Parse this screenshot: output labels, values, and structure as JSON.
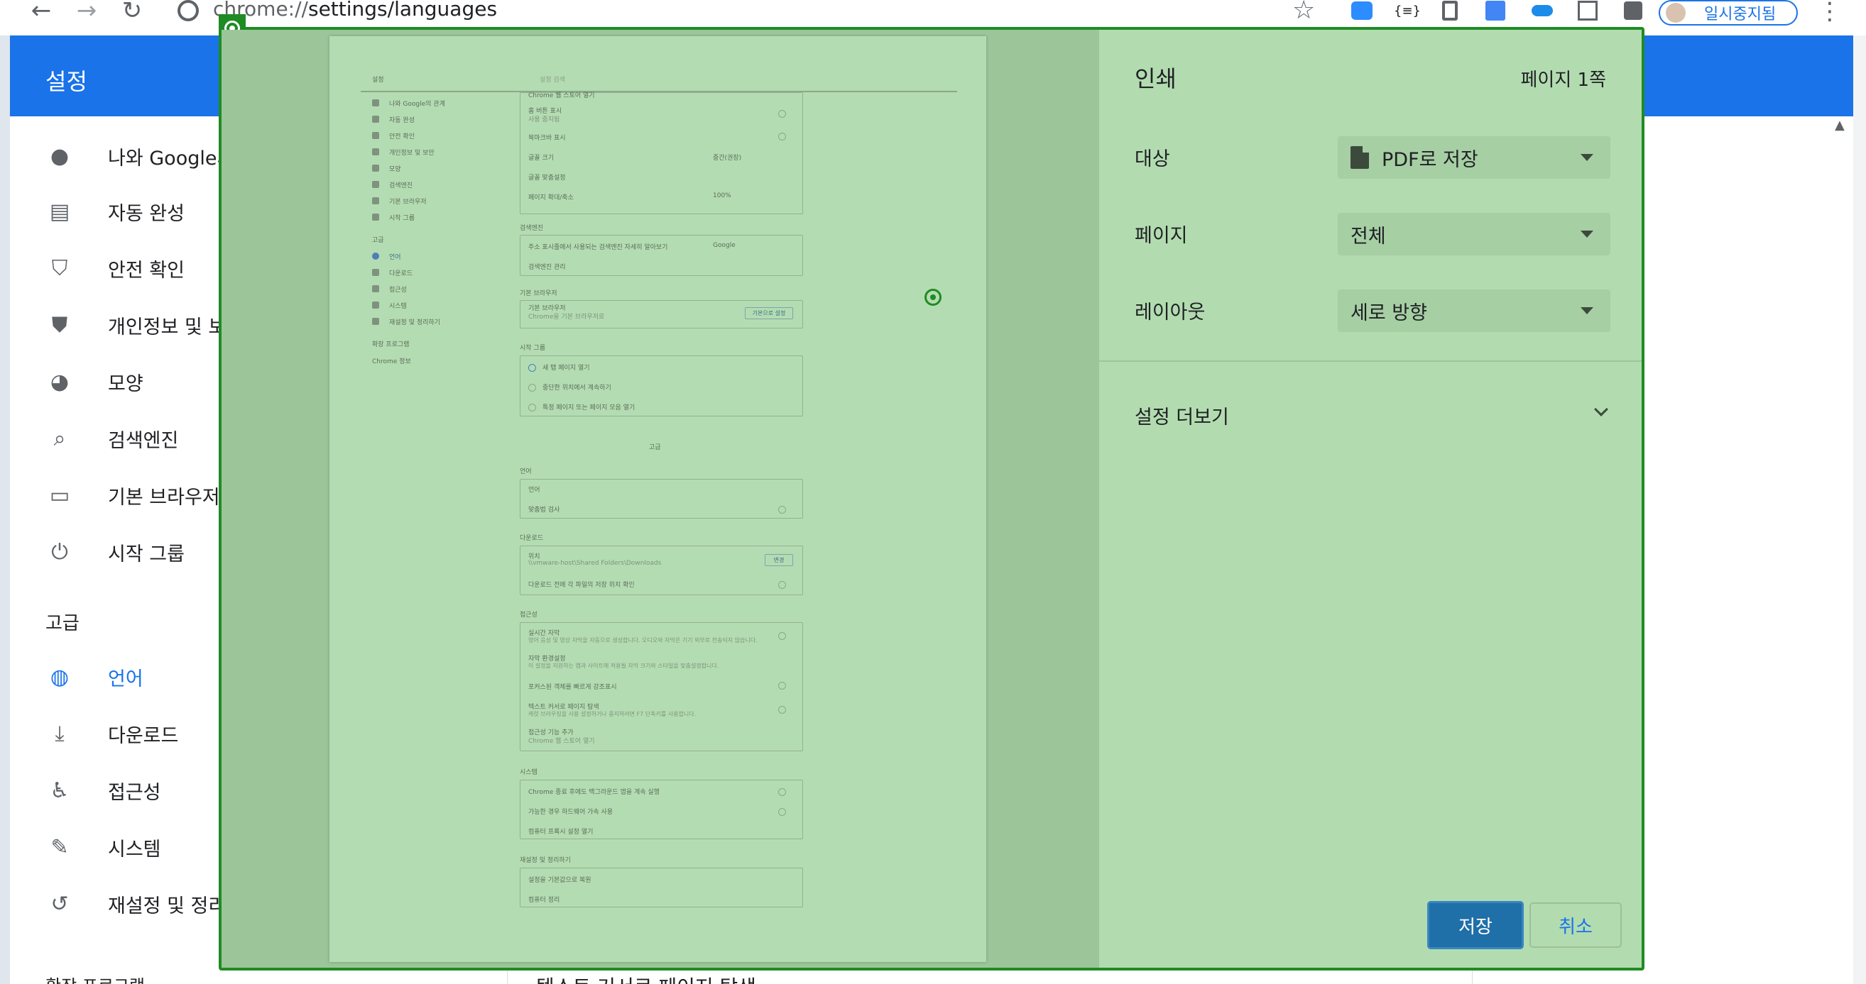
{
  "browser": {
    "back": "←",
    "forward": "→",
    "reload": "↻",
    "url_host": "chrome://",
    "url_path": "settings/languages",
    "url_prefix_hidden": "Chrome",
    "star": "☆",
    "profile_label": "일시중지됨",
    "more": "⋮",
    "extensions": [
      "zoom-icon",
      "json-viewer-icon",
      "office-icon",
      "google-translate-icon",
      "onedrive-icon",
      "uipath-icon",
      "puzzle-icon"
    ]
  },
  "settings": {
    "title": "설정",
    "sidebar": [
      {
        "label": "나와 Google의",
        "icon": "person-icon"
      },
      {
        "label": "자동 완성",
        "icon": "clipboard-icon"
      },
      {
        "label": "안전 확인",
        "icon": "shield-check-icon"
      },
      {
        "label": "개인정보 및 보",
        "icon": "shield-half-icon"
      },
      {
        "label": "모양",
        "icon": "palette-icon"
      },
      {
        "label": "검색엔진",
        "icon": "search-icon"
      },
      {
        "label": "기본 브라우저",
        "icon": "browser-icon"
      },
      {
        "label": "시작 그룹",
        "icon": "power-icon"
      }
    ],
    "advanced_label": "고급",
    "advanced_items": [
      {
        "label": "언어",
        "icon": "globe-icon"
      },
      {
        "label": "다운로드",
        "icon": "download-icon"
      },
      {
        "label": "접근성",
        "icon": "accessibility-icon"
      },
      {
        "label": "시스템",
        "icon": "wrench-icon"
      },
      {
        "label": "재설정 및 정리",
        "icon": "history-icon"
      }
    ],
    "below_sidebar": "확장 프로그램",
    "below_main": "텍스트 커서로 페이지 탐색"
  },
  "print_dialog": {
    "title": "인쇄",
    "page_count": "페이지 1쪽",
    "destination_label": "대상",
    "destination_value": "PDF로 저장",
    "pages_label": "페이지",
    "pages_value": "전체",
    "layout_label": "레이아웃",
    "layout_value": "세로 방향",
    "more_settings": "설정 더보기",
    "save": "저장",
    "cancel": "취소"
  },
  "preview": {
    "header_left": "설정",
    "header_search": "설정 검색",
    "nav": [
      "나와 Google의 관계",
      "자동 완성",
      "안전 확인",
      "개인정보 및 보안",
      "모양",
      "검색엔진",
      "기본 브라우저",
      "시작 그룹",
      "고급",
      "언어",
      "다운로드",
      "접근성",
      "시스템",
      "재설정 및 정리하기",
      "확장 프로그램",
      "Chrome 정보"
    ],
    "appearance_rows": [
      "Chrome 웹 스토어 열기",
      "홈 버튼 표시",
      "사용 중지됨",
      "북마크바 표시",
      "글꼴 크기",
      "중간(권장)",
      "글꼴 맞춤설정",
      "페이지 확대/축소",
      "100%"
    ],
    "search_section": "검색엔진",
    "search_rows": [
      "주소 표시줄에서 사용되는 검색엔진 자세히 알아보기",
      "Google",
      "검색엔진 관리"
    ],
    "browser_section": "기본 브라우저",
    "browser_rows": [
      "기본 브라우저",
      "Chrome을 기본 브라우저로",
      "기본으로 설정"
    ],
    "startup_section": "시작 그룹",
    "startup_rows": [
      "새 탭 페이지 열기",
      "중단한 위치에서 계속하기",
      "특정 페이지 또는 페이지 모음 열기"
    ],
    "advanced_toggle": "고급",
    "language_section": "언어",
    "language_rows": [
      "언어",
      "맞춤법 검사"
    ],
    "download_section": "다운로드",
    "download_rows": [
      "위치",
      "\\\\vmware-host\\Shared Folders\\Downloads",
      "변경",
      "다운로드 전에 각 파일의 저장 위치 확인"
    ],
    "a11y_section": "접근성",
    "a11y_rows": [
      "실시간 자막",
      "영어 음성 및 영상 자막을 자동으로 생성합니다. 오디오와 자막은 기기 외부로 전송되지 않습니다.",
      "자막 환경설정",
      "이 설정을 지원하는 앱과 사이트에 적용될 자막 크기와 스타일을 맞춤설정합니다.",
      "포커스된 객체를 빠르게 강조표시",
      "텍스트 커서로 페이지 탐색",
      "캐럿 브라우징을 사용 설정하거나 중지하려면 F7 단축키를 사용합니다.",
      "접근성 기능 추가",
      "Chrome 웹 스토어 열기"
    ],
    "system_section": "시스템",
    "system_rows": [
      "Chrome 종료 후에도 백그라운드 앱을 계속 실행",
      "가능한 경우 하드웨어 가속 사용",
      "컴퓨터 프록시 설정 열기"
    ],
    "reset_section": "재설정 및 정리하기",
    "reset_rows": [
      "설정을 기본값으로 복원",
      "컴퓨터 정리"
    ]
  },
  "colors": {
    "accent": "#1a73e8",
    "overlay_border": "#1f8b24",
    "overlay_fill": "#b2dcb0",
    "save_button": "#1f6fa8"
  }
}
